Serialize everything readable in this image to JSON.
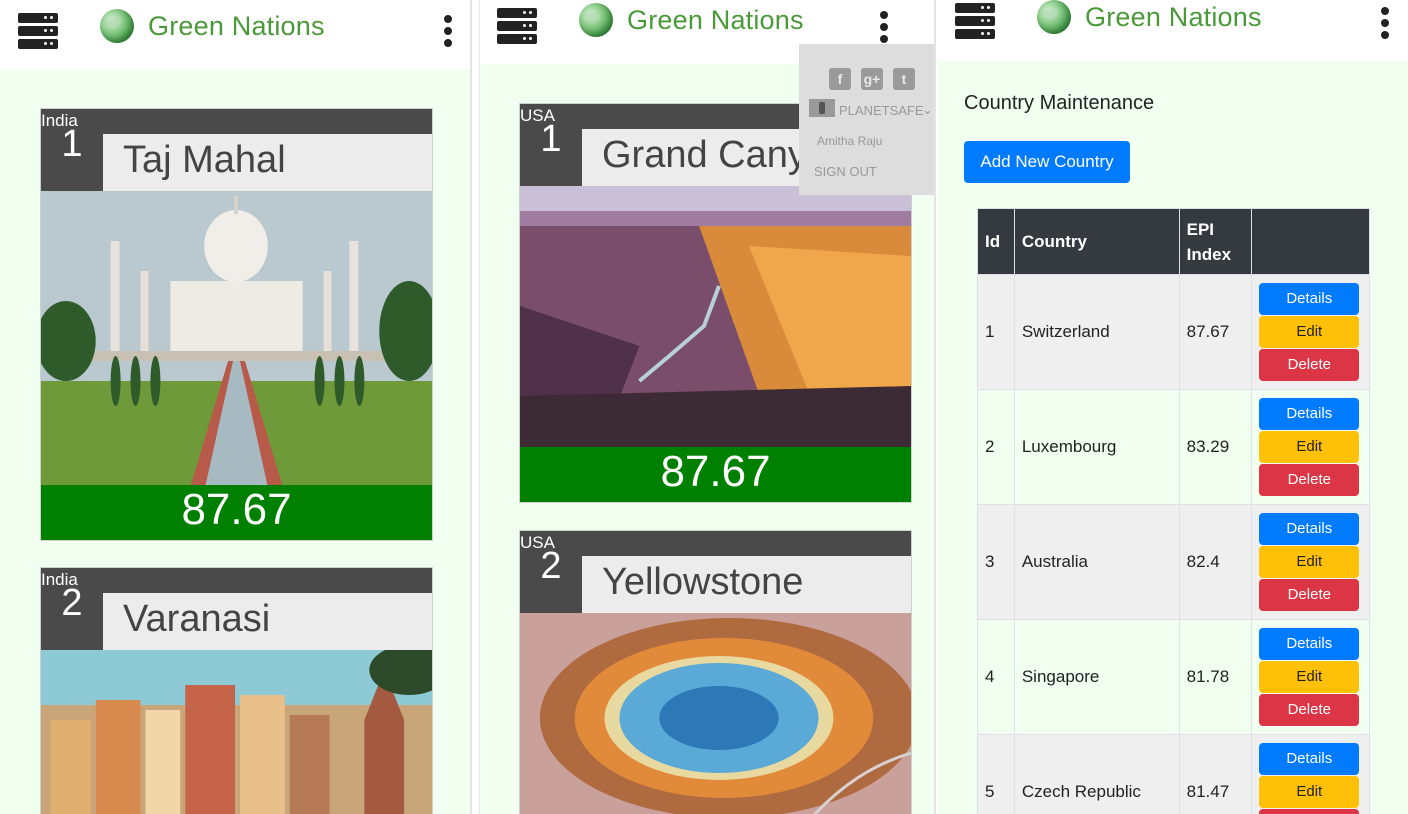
{
  "brand": {
    "name": "Green Nations"
  },
  "panel1": {
    "cards": [
      {
        "country": "India",
        "rank": "1",
        "title": "Taj Mahal",
        "score": "87.67"
      },
      {
        "country": "India",
        "rank": "2",
        "title": "Varanasi"
      }
    ]
  },
  "panel2": {
    "cards": [
      {
        "country": "USA",
        "rank": "1",
        "title": "Grand Canyon",
        "score": "87.67"
      },
      {
        "country": "USA",
        "rank": "2",
        "title": "Yellowstone"
      }
    ],
    "dropdown": {
      "social": [
        {
          "icon": "facebook-icon",
          "glyph": "f"
        },
        {
          "icon": "google-plus-icon",
          "glyph": "g+"
        },
        {
          "icon": "twitter-icon",
          "glyph": "t"
        }
      ],
      "org": "PLANETSAFE",
      "user": "Amitha Raju",
      "signout": "SIGN OUT"
    }
  },
  "panel3": {
    "title": "Country Maintenance",
    "add_button": "Add New Country",
    "table": {
      "headers": [
        "Id",
        "Country",
        "EPI Index",
        ""
      ],
      "rows": [
        {
          "id": "1",
          "country": "Switzerland",
          "epi": "87.67"
        },
        {
          "id": "2",
          "country": "Luxembourg",
          "epi": "83.29"
        },
        {
          "id": "3",
          "country": "Australia",
          "epi": "82.4"
        },
        {
          "id": "4",
          "country": "Singapore",
          "epi": "81.78"
        },
        {
          "id": "5",
          "country": "Czech Republic",
          "epi": "81.47"
        }
      ],
      "actions": {
        "details": "Details",
        "edit": "Edit",
        "delete": "Delete"
      }
    }
  },
  "colors": {
    "accent_green": "#008000",
    "brand_green": "#4a9a3a",
    "primary": "#007bff",
    "warning": "#ffc107",
    "danger": "#dc3545",
    "page_bg": "#f0fff0"
  }
}
